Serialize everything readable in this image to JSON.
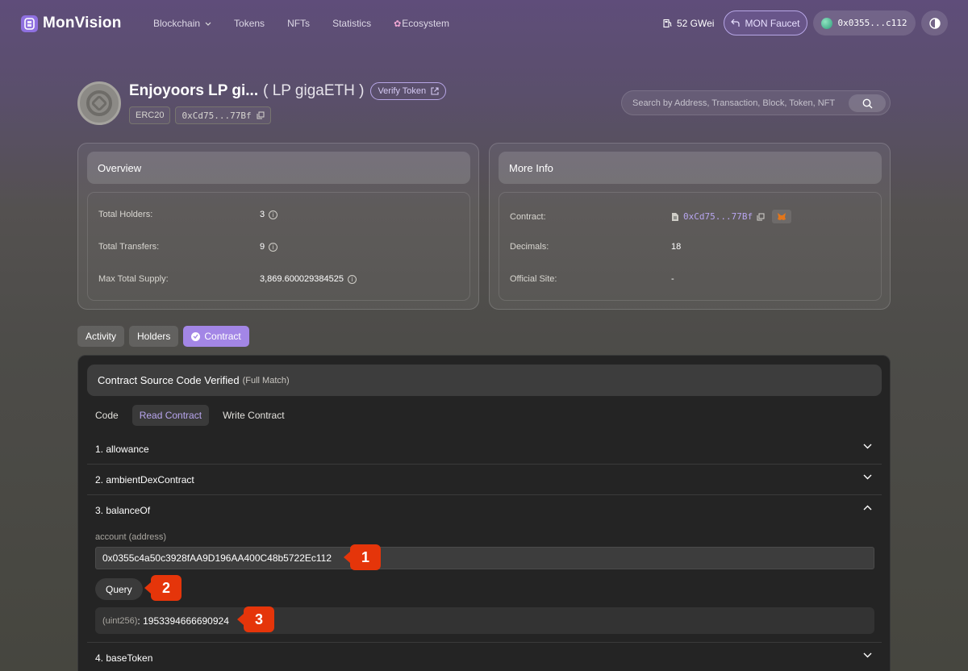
{
  "nav": {
    "brand": "MonVision",
    "links": [
      "Blockchain",
      "Tokens",
      "NFTs",
      "Statistics",
      "Ecosystem"
    ],
    "gas": "52 GWei",
    "faucet": "MON Faucet",
    "wallet": "0x0355...c112"
  },
  "token": {
    "name": "Enjoyoors LP gi...",
    "symbol": "( LP gigaETH )",
    "verify_label": "Verify Token",
    "standard": "ERC20",
    "address_short": "0xCd75...77Bf"
  },
  "search": {
    "placeholder": "Search by Address, Transaction, Block, Token, NFT"
  },
  "overview": {
    "title": "Overview",
    "rows": [
      {
        "label": "Total Holders:",
        "value": "3"
      },
      {
        "label": "Total Transfers:",
        "value": "9"
      },
      {
        "label": "Max Total Supply:",
        "value": "3,869.600029384525"
      }
    ]
  },
  "more_info": {
    "title": "More Info",
    "contract_label": "Contract:",
    "contract_value": "0xCd75...77Bf",
    "decimals_label": "Decimals:",
    "decimals_value": "18",
    "site_label": "Official Site:",
    "site_value": "-"
  },
  "tabs": [
    "Activity",
    "Holders",
    "Contract"
  ],
  "contract": {
    "heading": "Contract Source Code Verified",
    "match": "(Full Match)",
    "subtabs": [
      "Code",
      "Read Contract",
      "Write Contract"
    ],
    "functions": [
      "1. allowance",
      "2. ambientDexContract",
      "3. balanceOf",
      "4. baseToken"
    ],
    "param_label": "account (address)",
    "param_value": "0x0355c4a50c3928fAA9D196AA400C48b5722Ec112",
    "query_label": "Query",
    "result_type": "(uint256)",
    "result_value": "1953394666690924"
  },
  "callouts": [
    "1",
    "2",
    "3"
  ],
  "colors": {
    "accent": "#a386e6",
    "callout": "#e5350a",
    "link": "#b8a6f0"
  }
}
